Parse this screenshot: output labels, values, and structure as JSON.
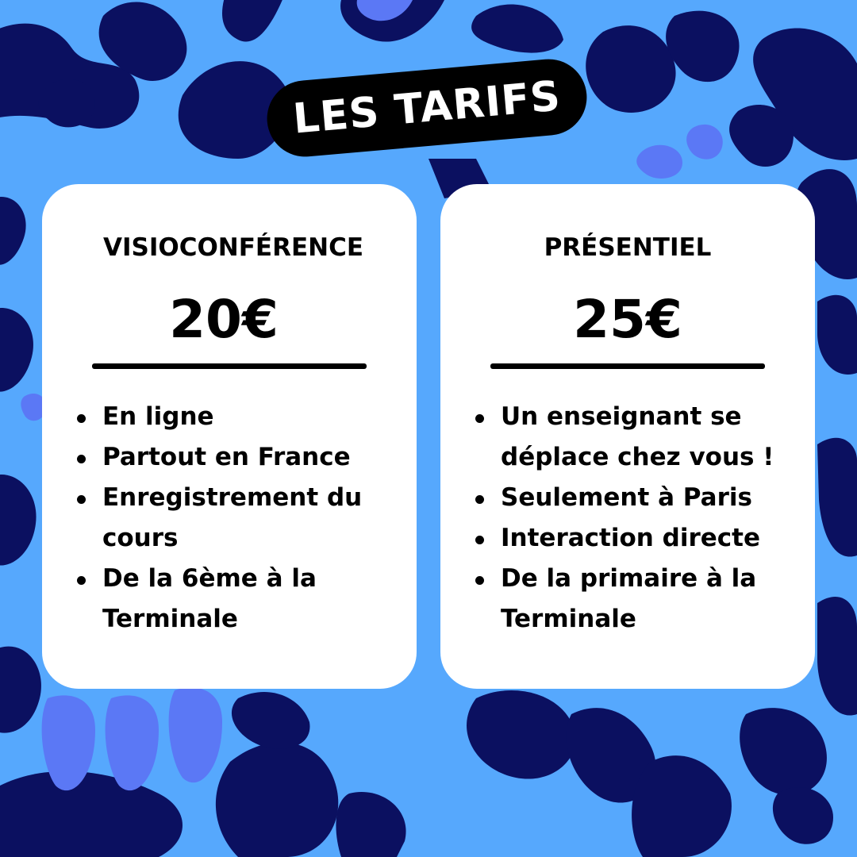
{
  "colors": {
    "background": "#56a8fd",
    "blob_dark": "#0b1060",
    "blob_light": "#5b78f5",
    "card": "#ffffff",
    "text": "#000000",
    "pill": "#000000"
  },
  "title": "LES TARIFS",
  "cards": [
    {
      "heading": "VISIOCONFÉRENCE",
      "price": "20€",
      "features": [
        "En ligne",
        "Partout en France",
        "Enregistrement du cours",
        "De la 6ème à la Terminale"
      ]
    },
    {
      "heading": "PRÉSENTIEL",
      "price": "25€",
      "features": [
        "Un enseignant se déplace chez vous !",
        "Seulement à Paris",
        "Interaction directe",
        "De la primaire à la Terminale"
      ]
    }
  ]
}
